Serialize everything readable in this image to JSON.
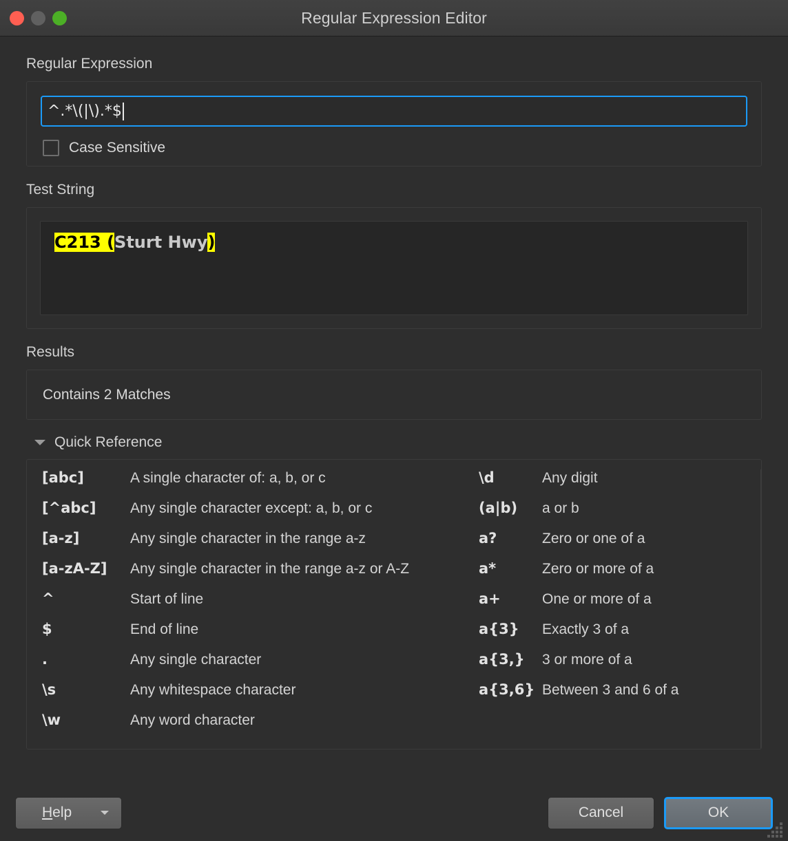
{
  "window": {
    "title": "Regular Expression Editor",
    "controls": {
      "close": "close-button",
      "minimize": "minimize-button",
      "zoom": "zoom-button"
    },
    "accent_color": "#1b9af7",
    "highlight_color": "#ffff00",
    "background_color": "#2e2e2e"
  },
  "regex_section": {
    "label": "Regular Expression",
    "input_value": "^.*\\(|\\).*$",
    "input_placeholder": "",
    "case_sensitive": {
      "label": "Case Sensitive",
      "checked": false
    }
  },
  "test_section": {
    "label": "Test String",
    "text_parts": [
      {
        "text": "C213 (",
        "highlighted": true
      },
      {
        "text": "Sturt Hwy",
        "highlighted": false
      },
      {
        "text": ")",
        "highlighted": true
      }
    ],
    "full_text": "C213 (Sturt Hwy)"
  },
  "results_section": {
    "label": "Results",
    "value": "Contains 2 Matches",
    "match_count": 2
  },
  "quick_reference": {
    "title": "Quick Reference",
    "expanded": true,
    "left_column": [
      {
        "pattern": "[abc]",
        "description": "A single character of: a, b, or c"
      },
      {
        "pattern": "[^abc]",
        "description": "Any single character except: a, b, or c"
      },
      {
        "pattern": "[a-z]",
        "description": "Any single character in the range a-z"
      },
      {
        "pattern": "[a-zA-Z]",
        "description": "Any single character in the range a-z or A-Z"
      },
      {
        "pattern": "^",
        "description": "Start of line"
      },
      {
        "pattern": "$",
        "description": "End of line"
      },
      {
        "pattern": ".",
        "description": "Any single character"
      },
      {
        "pattern": "\\s",
        "description": "Any whitespace character"
      },
      {
        "pattern": "\\w",
        "description": "Any word character"
      }
    ],
    "right_column": [
      {
        "pattern": "\\d",
        "description": "Any digit"
      },
      {
        "pattern": "(a|b)",
        "description": "a or b"
      },
      {
        "pattern": "a?",
        "description": "Zero or one of a"
      },
      {
        "pattern": "a*",
        "description": "Zero or more of a"
      },
      {
        "pattern": "a+",
        "description": "One or more of a"
      },
      {
        "pattern": "a{3}",
        "description": "Exactly 3 of a"
      },
      {
        "pattern": "a{3,}",
        "description": "3 or more of a"
      },
      {
        "pattern": "a{3,6}",
        "description": "Between 3 and 6 of a"
      }
    ]
  },
  "buttons": {
    "help": {
      "label_prefix": "H",
      "label_rest": "elp",
      "full": "Help"
    },
    "cancel": "Cancel",
    "ok": "OK"
  }
}
